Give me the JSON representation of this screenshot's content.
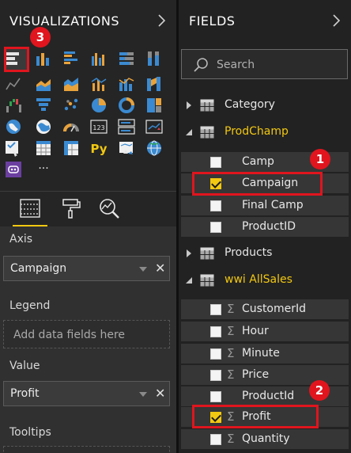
{
  "visualizations": {
    "title": "VISUALIZATIONS",
    "visual_icons": [
      "stacked-bar-chart",
      "stacked-column-chart",
      "clustered-bar-chart",
      "clustered-column-chart",
      "100pct-stacked-bar-chart",
      "100pct-stacked-column-chart",
      "line-chart",
      "area-chart",
      "stacked-area-chart",
      "line-and-column-chart",
      "line-and-clustered-column-chart",
      "ribbon-chart",
      "waterfall-chart",
      "funnel-chart",
      "scatter-chart",
      "pie-chart",
      "donut-chart",
      "treemap",
      "map",
      "filled-map",
      "gauge",
      "card",
      "multi-row-card",
      "kpi",
      "slicer",
      "table",
      "matrix",
      "python-visual",
      "arcgis-map",
      "globe-map",
      "custom-visual",
      "more-visuals"
    ],
    "card_text": "123",
    "python_text": "Py",
    "more_text": "···",
    "selected_visual": "stacked-bar-chart",
    "wells": {
      "axis_label": "Axis",
      "axis_value": "Campaign",
      "legend_label": "Legend",
      "legend_placeholder": "Add data fields here",
      "value_label": "Value",
      "value_value": "Profit",
      "tooltips_label": "Tooltips"
    }
  },
  "fields": {
    "title": "FIELDS",
    "search_placeholder": "Search",
    "tables": [
      {
        "name": "Category",
        "expanded": false
      },
      {
        "name": "ProdChamp",
        "expanded": true,
        "fields": [
          {
            "name": "Camp",
            "checked": false,
            "sigma": false
          },
          {
            "name": "Campaign",
            "checked": true,
            "sigma": false
          },
          {
            "name": "Final Camp",
            "checked": false,
            "sigma": false
          },
          {
            "name": "ProductID",
            "checked": false,
            "sigma": false
          }
        ]
      },
      {
        "name": "Products",
        "expanded": false
      },
      {
        "name": "wwi AllSales",
        "expanded": true,
        "fields": [
          {
            "name": "CustomerId",
            "checked": false,
            "sigma": true
          },
          {
            "name": "Hour",
            "checked": false,
            "sigma": true
          },
          {
            "name": "Minute",
            "checked": false,
            "sigma": true
          },
          {
            "name": "Price",
            "checked": false,
            "sigma": true
          },
          {
            "name": "ProductId",
            "checked": false,
            "sigma": false
          },
          {
            "name": "Profit",
            "checked": true,
            "sigma": true
          },
          {
            "name": "Quantity",
            "checked": false,
            "sigma": true
          }
        ]
      }
    ]
  },
  "annotations": {
    "badge_1": "1",
    "badge_2": "2",
    "badge_3": "3"
  },
  "colors": {
    "accent": "#f2c811",
    "highlight": "#e0151e",
    "icon_blue": "#3b8ad1",
    "icon_orange": "#e8a23c",
    "pane_bg": "#252525"
  }
}
